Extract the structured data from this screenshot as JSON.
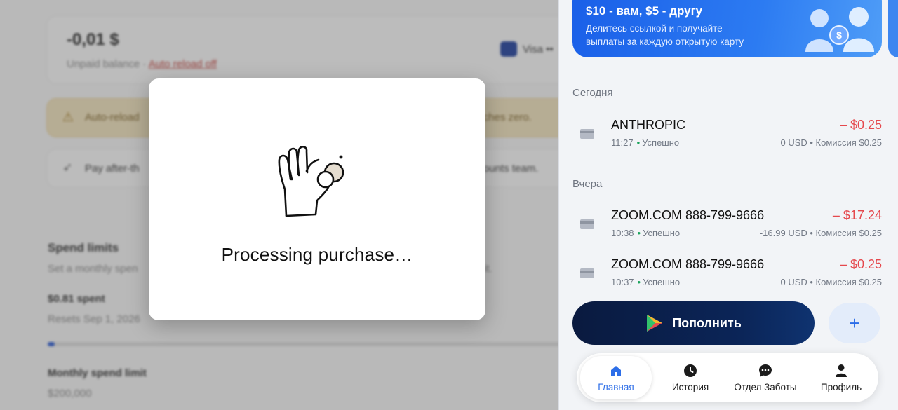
{
  "billing": {
    "balance_amount": "-0,01 $",
    "balance_label": "Unpaid balance ·",
    "auto_reload_link": "Auto reload off",
    "card_brand": "Visa ••",
    "warning_text": "Auto-reload",
    "warning_tail": "reaches zero.",
    "pay_after_text": "Pay after-th",
    "pay_after_tail": "ounts team.",
    "spend_limits_title": "Spend limits",
    "spend_limits_desc": "Set a monthly spen",
    "spend_limits_desc_tail": "it.",
    "spent_label": "$0.81 spent",
    "resets_label": "Resets Sep 1, 2026",
    "spend_progress_fraction": 0.008,
    "monthly_limit_label": "Monthly spend limit",
    "monthly_limit_value": "$200,000"
  },
  "modal": {
    "message": "Processing purchase…",
    "illustration": "ok-hand-with-coin"
  },
  "phone": {
    "promo": {
      "title": "$10 - вам, $5 - другу",
      "line1": "Делитесь ссылкой и получайте",
      "line2": "выплаты за каждую открытую карту"
    },
    "sections": {
      "today": "Сегодня",
      "yesterday": "Вчера"
    },
    "transactions": [
      {
        "name": "ANTHROPIC",
        "amount": "– $0.25",
        "time": "11:27",
        "status": "Успешно",
        "detail": "0 USD • Комиссия $0.25"
      },
      {
        "name": "ZOOM.COM 888-799-9666",
        "amount": "– $17.24",
        "time": "10:38",
        "status": "Успешно",
        "detail": "-16.99 USD • Комиссия $0.25"
      },
      {
        "name": "ZOOM.COM 888-799-9666",
        "amount": "– $0.25",
        "time": "10:37",
        "status": "Успешно",
        "detail": "0 USD • Комиссия $0.25"
      }
    ],
    "topup_label": "Пополнить",
    "plus_label": "+",
    "nav": [
      {
        "label": "Главная",
        "icon": "home-icon"
      },
      {
        "label": "История",
        "icon": "clock-icon"
      },
      {
        "label": "Отдел Заботы",
        "icon": "chat-icon"
      },
      {
        "label": "Профиль",
        "icon": "person-icon"
      }
    ],
    "colors": {
      "accent": "#2d6ee8",
      "negative_amount": "#e5484d",
      "success_dot": "#1aa35b",
      "topup_button": "#0b2558"
    }
  }
}
